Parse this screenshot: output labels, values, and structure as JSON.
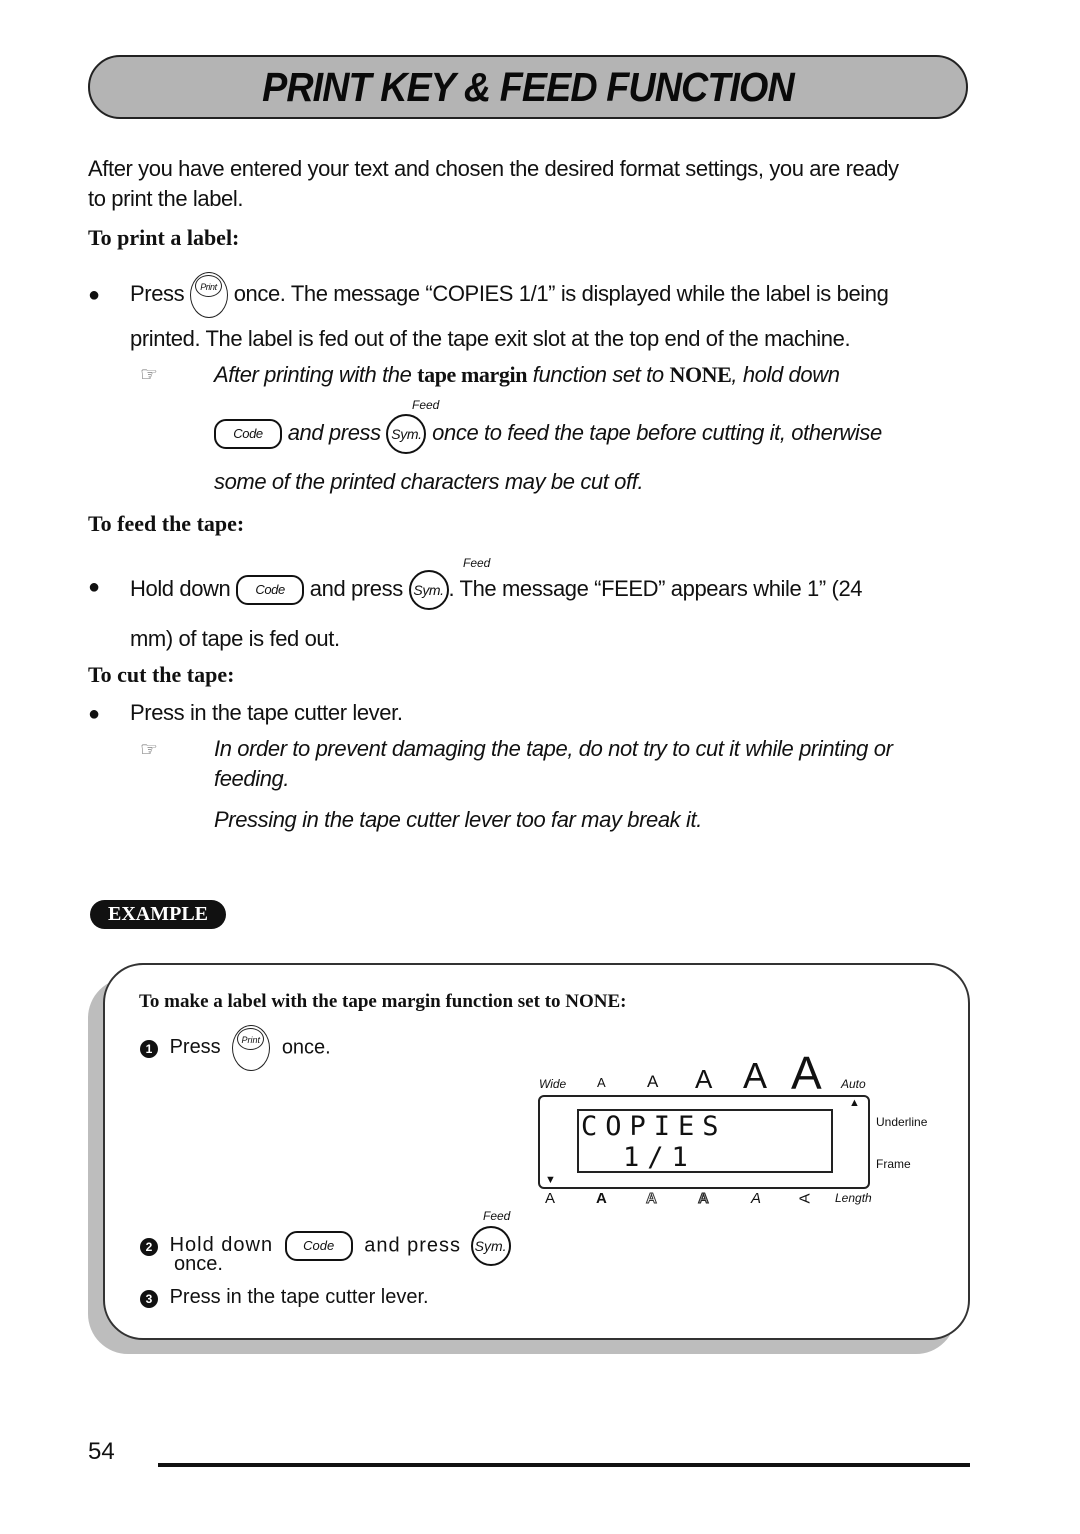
{
  "page": {
    "title": "PRINT KEY & FEED FUNCTION",
    "intro": [
      "After you have entered your text and chosen the desired format settings, you are ready",
      "to print the label."
    ],
    "page_number": "54"
  },
  "sections": {
    "print": {
      "heading": "To print a label:",
      "bullet_press": "Press",
      "bullet_rest": "once. The message “COPIES 1/1” is displayed while the label is being",
      "bullet_line2": "printed. The label is fed out of the tape exit slot at the top end of the machine.",
      "note_part1": "After printing with the ",
      "note_bold1": "tape margin",
      "note_part2": " function set to ",
      "note_bold2": "NONE",
      "note_part3": ", hold down",
      "note_and_press": "and press",
      "note_line2_rest": "once to feed the tape before cutting it, otherwise",
      "note_line3": "some of the printed characters may be cut off."
    },
    "feed": {
      "heading": "To feed the tape:",
      "hold_down": "Hold down",
      "and_press": "and press",
      "rest": ". The message “FEED” appears while 1” (24",
      "line2": "mm) of tape is fed out."
    },
    "cut": {
      "heading": "To cut the tape:",
      "bullet": "Press in the tape cutter lever.",
      "note1_line1": "In order to prevent damaging the tape, do not try to cut it while printing or",
      "note1_line2": "feeding.",
      "note2": "Pressing in the tape cutter lever too far may break it."
    }
  },
  "keys": {
    "print": "Print",
    "code": "Code",
    "sym": "Sym.",
    "feed_label": "Feed"
  },
  "example": {
    "badge": "EXAMPLE",
    "heading": "To make a label with the tape margin function set to NONE:",
    "steps": [
      {
        "num": "1",
        "pre": "Press",
        "post": "once."
      },
      {
        "num": "2",
        "pre": "Hold down",
        "mid": "and press",
        "post": "once."
      },
      {
        "num": "3",
        "text": "Press in the tape cutter lever."
      }
    ],
    "lcd": {
      "line1": "COPIES",
      "line2": "1/1",
      "top_labels": {
        "wide": "Wide",
        "auto": "Auto"
      },
      "size_glyph": "A",
      "right_labels": {
        "underline": "Underline",
        "frame": "Frame"
      },
      "bottom_label_length": "Length",
      "up_arrow": "▲",
      "down_arrow": "▼"
    }
  },
  "icons": {
    "bullet": "●",
    "note": "☞"
  }
}
